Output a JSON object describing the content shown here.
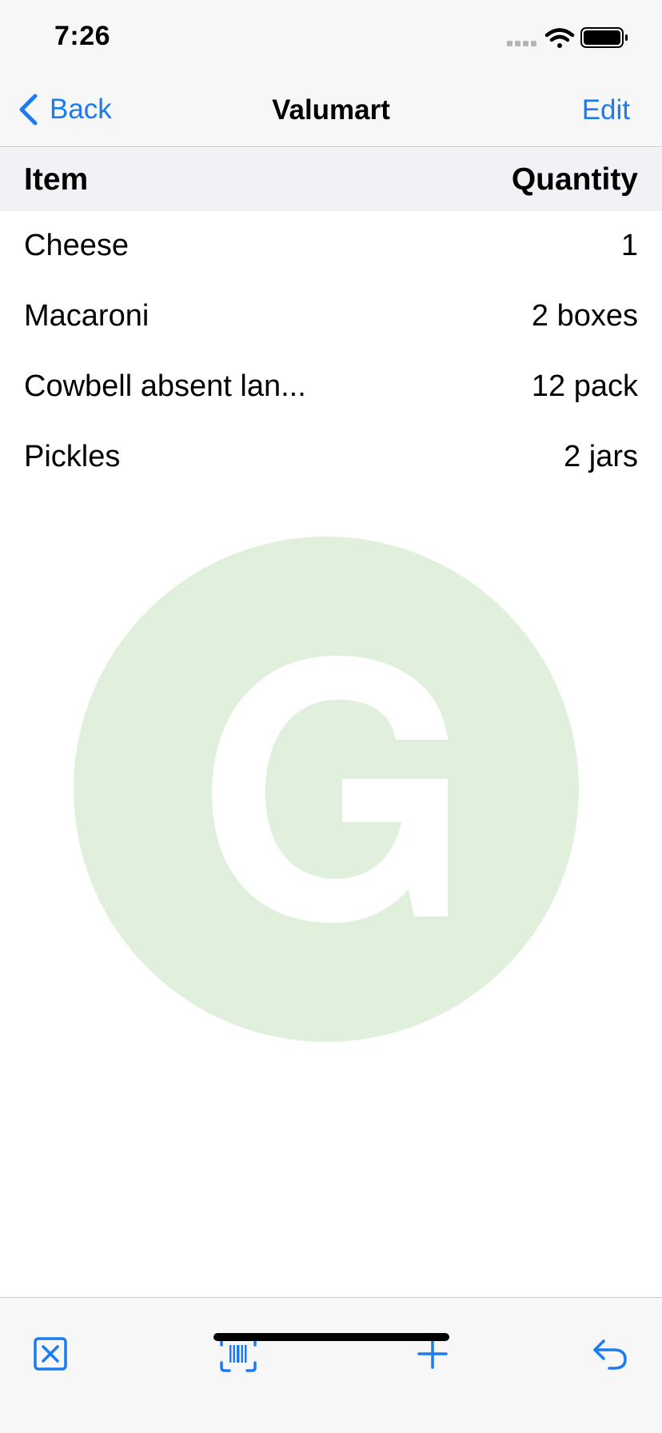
{
  "status_bar": {
    "time": "7:26",
    "icons": [
      "cellular-signal-icon",
      "wifi-icon",
      "battery-icon"
    ]
  },
  "nav": {
    "back_label": "Back",
    "title": "Valumart",
    "edit_label": "Edit"
  },
  "table": {
    "headers": {
      "item": "Item",
      "quantity": "Quantity"
    },
    "rows": [
      {
        "item": "Cheese",
        "quantity": "1"
      },
      {
        "item": "Macaroni",
        "quantity": "2 boxes"
      },
      {
        "item": "Cowbell absent lan...",
        "quantity": "12 pack"
      },
      {
        "item": "Pickles",
        "quantity": "2 jars"
      }
    ]
  },
  "watermark_logo": {
    "letter": "G",
    "circle_color": "#e0f0dc",
    "letter_color": "#ffffff"
  },
  "toolbar": {
    "icons": [
      "clear-list-icon",
      "barcode-scan-icon",
      "add-icon",
      "undo-icon"
    ]
  },
  "colors": {
    "accent": "#1a7cf0",
    "bar_background": "#f7f7f7",
    "header_background": "#f2f2f6"
  }
}
